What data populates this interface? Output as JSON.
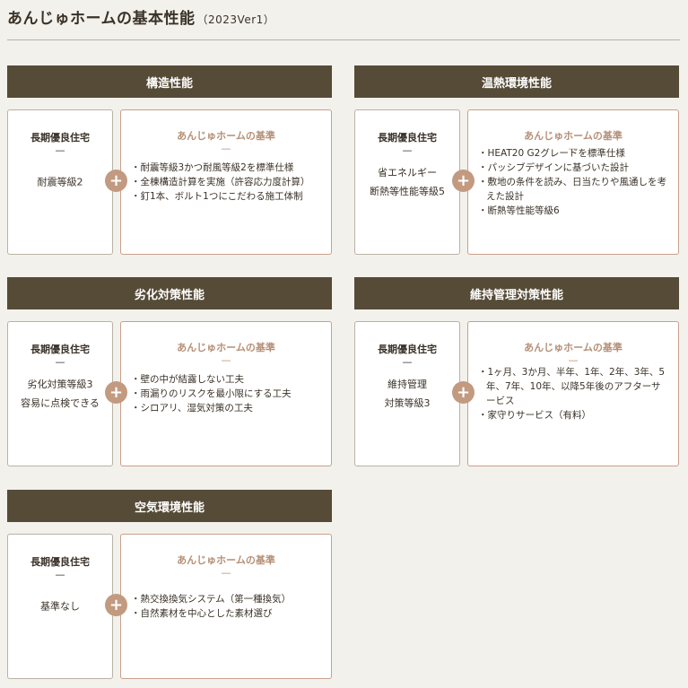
{
  "page": {
    "title": "あんじゅホームの基本性能",
    "version": "（2023Ver1）"
  },
  "plus_symbol": "+",
  "dash": "—",
  "sections": [
    {
      "header": "構造性能",
      "left_title": "長期優良住宅",
      "left_value": "耐震等級2",
      "right_title": "あんじゅホームの基準",
      "items": [
        "耐震等級3かつ耐風等級2を標準仕様",
        "全棟構造計算を実施（許容応力度計算）",
        "釘1本、ボルト1つにこだわる施工体制"
      ]
    },
    {
      "header": "温熱環境性能",
      "left_title": "長期優良住宅",
      "left_value": "省エネルギー\n断熱等性能等級5",
      "right_title": "あんじゅホームの基準",
      "items": [
        "HEAT20 G2グレードを標準仕様",
        "パッシブデザインに基づいた設計",
        "敷地の条件を読み、日当たりや風通しを考えた設計",
        "断熱等性能等級6"
      ]
    },
    {
      "header": "劣化対策性能",
      "left_title": "長期優良住宅",
      "left_value": "劣化対策等級3\n容易に点検できる",
      "right_title": "あんじゅホームの基準",
      "items": [
        "壁の中が結露しない工夫",
        "雨漏りのリスクを最小限にする工夫",
        "シロアリ、湿気対策の工夫"
      ]
    },
    {
      "header": "維持管理対策性能",
      "left_title": "長期優良住宅",
      "left_value": "維持管理\n対策等級3",
      "right_title": "あんじゅホームの基準",
      "items": [
        "1ヶ月、3か月、半年、1年、2年、3年、5年、7年、10年、以降5年後のアフターサービス",
        "家守りサービス（有料）"
      ]
    },
    {
      "header": "空気環境性能",
      "left_title": "長期優良住宅",
      "left_value": "基準なし",
      "right_title": "あんじゅホームの基準",
      "items": [
        "熱交換換気システム（第一種換気）",
        "自然素材を中心とした素材選び"
      ]
    }
  ]
}
